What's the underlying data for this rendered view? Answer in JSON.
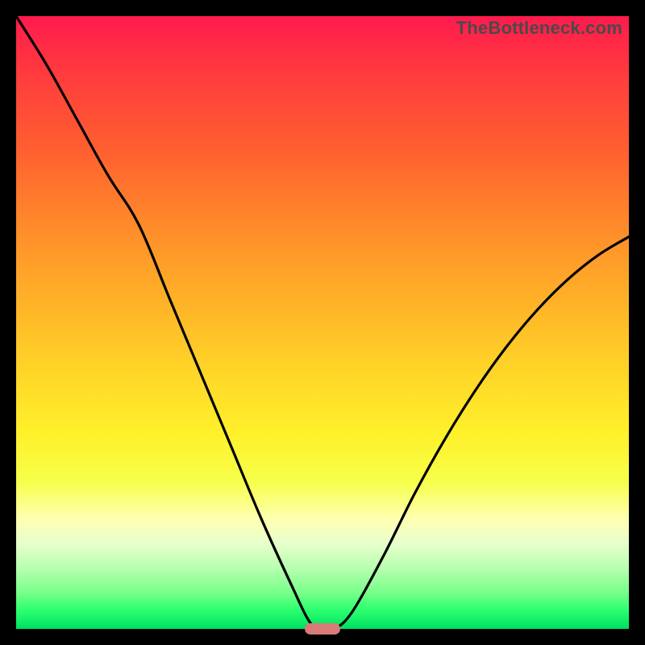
{
  "watermark": {
    "text": "TheBottleneck.com"
  },
  "colors": {
    "curve": "#000000",
    "marker": "#d87a78",
    "frame": "#000000"
  },
  "chart_data": {
    "type": "line",
    "title": "",
    "xlabel": "",
    "ylabel": "",
    "xlim": [
      0,
      100
    ],
    "ylim": [
      0,
      100
    ],
    "x": [
      0,
      5,
      10,
      15,
      20,
      25,
      30,
      35,
      40,
      45,
      48,
      50,
      52,
      55,
      60,
      65,
      70,
      75,
      80,
      85,
      90,
      95,
      100
    ],
    "values": [
      100,
      92,
      83,
      74,
      66,
      54,
      42,
      30,
      18,
      7,
      1,
      0,
      0,
      3,
      12,
      22,
      31,
      39,
      46,
      52,
      57,
      61,
      64
    ],
    "marker": {
      "x": 50,
      "y": 0,
      "width": 6
    },
    "grid": false,
    "legend": false,
    "notes": "Values read as percent of plot height from bottom; V-shaped bottleneck curve with minimum near x≈50."
  }
}
